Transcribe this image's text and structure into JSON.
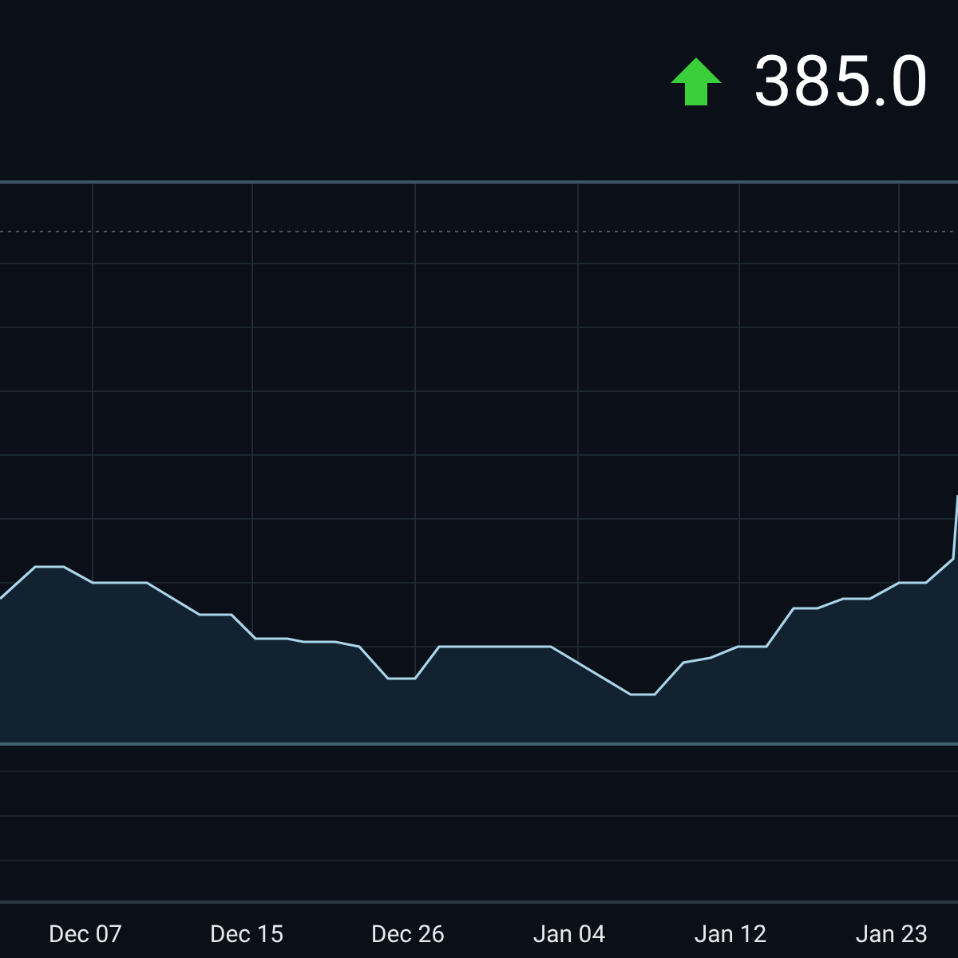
{
  "price": {
    "value": "385.0"
  },
  "x_axis": {
    "labels": [
      "Dec 07",
      "Dec 15",
      "Dec 26",
      "Jan 04",
      "Jan 12",
      "Jan 23"
    ]
  }
}
